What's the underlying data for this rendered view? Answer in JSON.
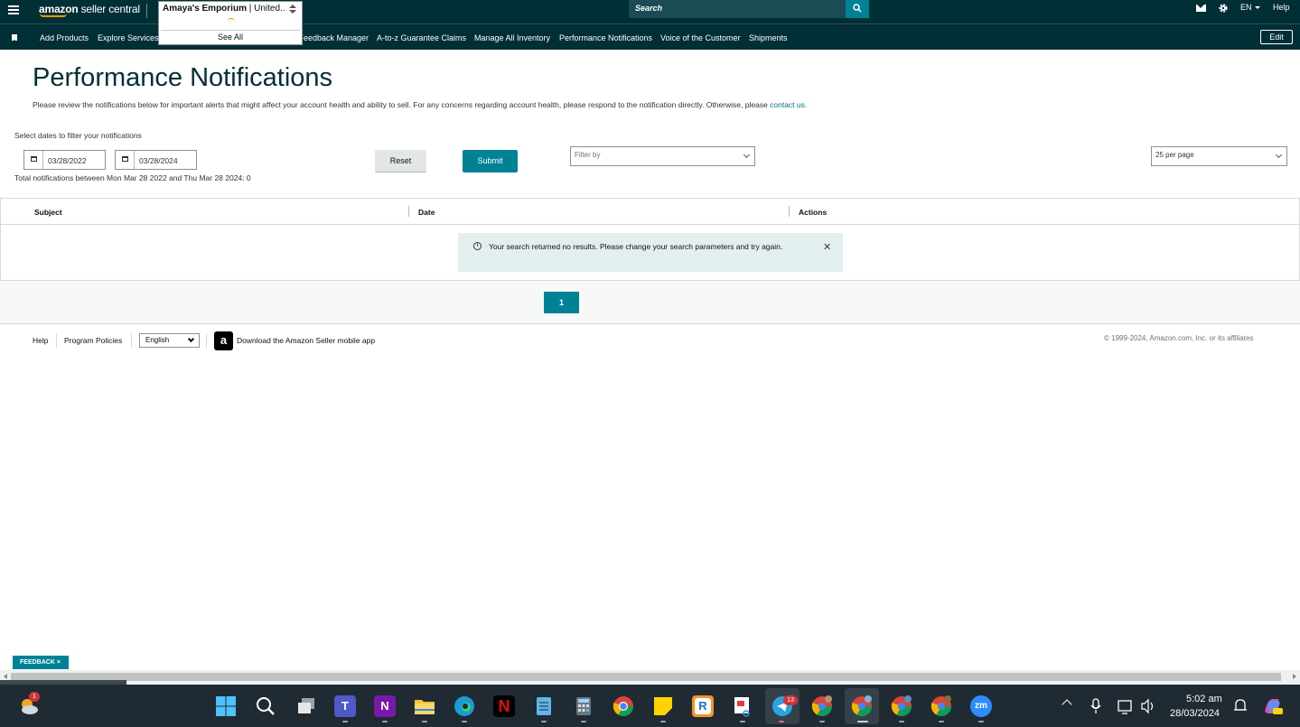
{
  "header": {
    "logo_bold": "amazon",
    "logo_text": " seller central",
    "store_name": "Amaya's Emporium",
    "store_region": " | United...",
    "store_see_all": "See All",
    "search_placeholder": "Search",
    "language": "EN",
    "help": "Help"
  },
  "nav": {
    "items": [
      "Add Products",
      "Explore Services",
      "Feedback Manager",
      "A-to-z Guarantee Claims",
      "Manage All Inventory",
      "Performance Notifications",
      "Voice of the Customer",
      "Shipments"
    ],
    "edit": "Edit"
  },
  "page": {
    "title": "Performance Notifications",
    "intro": "Please review the notifications below for important alerts that might affect your account health and ability to sell. For any concerns regarding account health, please respond to the notification directly. Otherwise, please ",
    "intro_link": "contact us.",
    "filter_label": "Select dates to filter your notifications",
    "start_date": "03/28/2022",
    "end_date": "03/28/2024",
    "reset": "Reset",
    "submit": "Submit",
    "filter_by_placeholder": "Filter by",
    "per_page": "25 per page",
    "totals": "Total notifications between Mon Mar 28 2022 and Thu Mar 28 2024: 0"
  },
  "table": {
    "columns": [
      "Subject",
      "Date",
      "Actions"
    ],
    "alert": "Your search returned no results. Please change your search parameters and try again.",
    "current_page": "1"
  },
  "footer": {
    "help": "Help",
    "program_policies": "Program Policies",
    "language": "English",
    "app_icon_letter": "a",
    "download_app": "Download the Amazon Seller mobile app",
    "copyright": "© 1999-2024, Amazon.com, Inc. or its affiliates"
  },
  "feedback": "FEEDBACK ×",
  "taskbar": {
    "weather_badge": "1",
    "telegram_badge": "13",
    "onenote_letter": "N",
    "zoom_text": "zm",
    "time": "5:02 am",
    "date": "28/03/2024",
    "colors": {
      "accent": "#008296",
      "header_bg": "#002f36"
    }
  }
}
